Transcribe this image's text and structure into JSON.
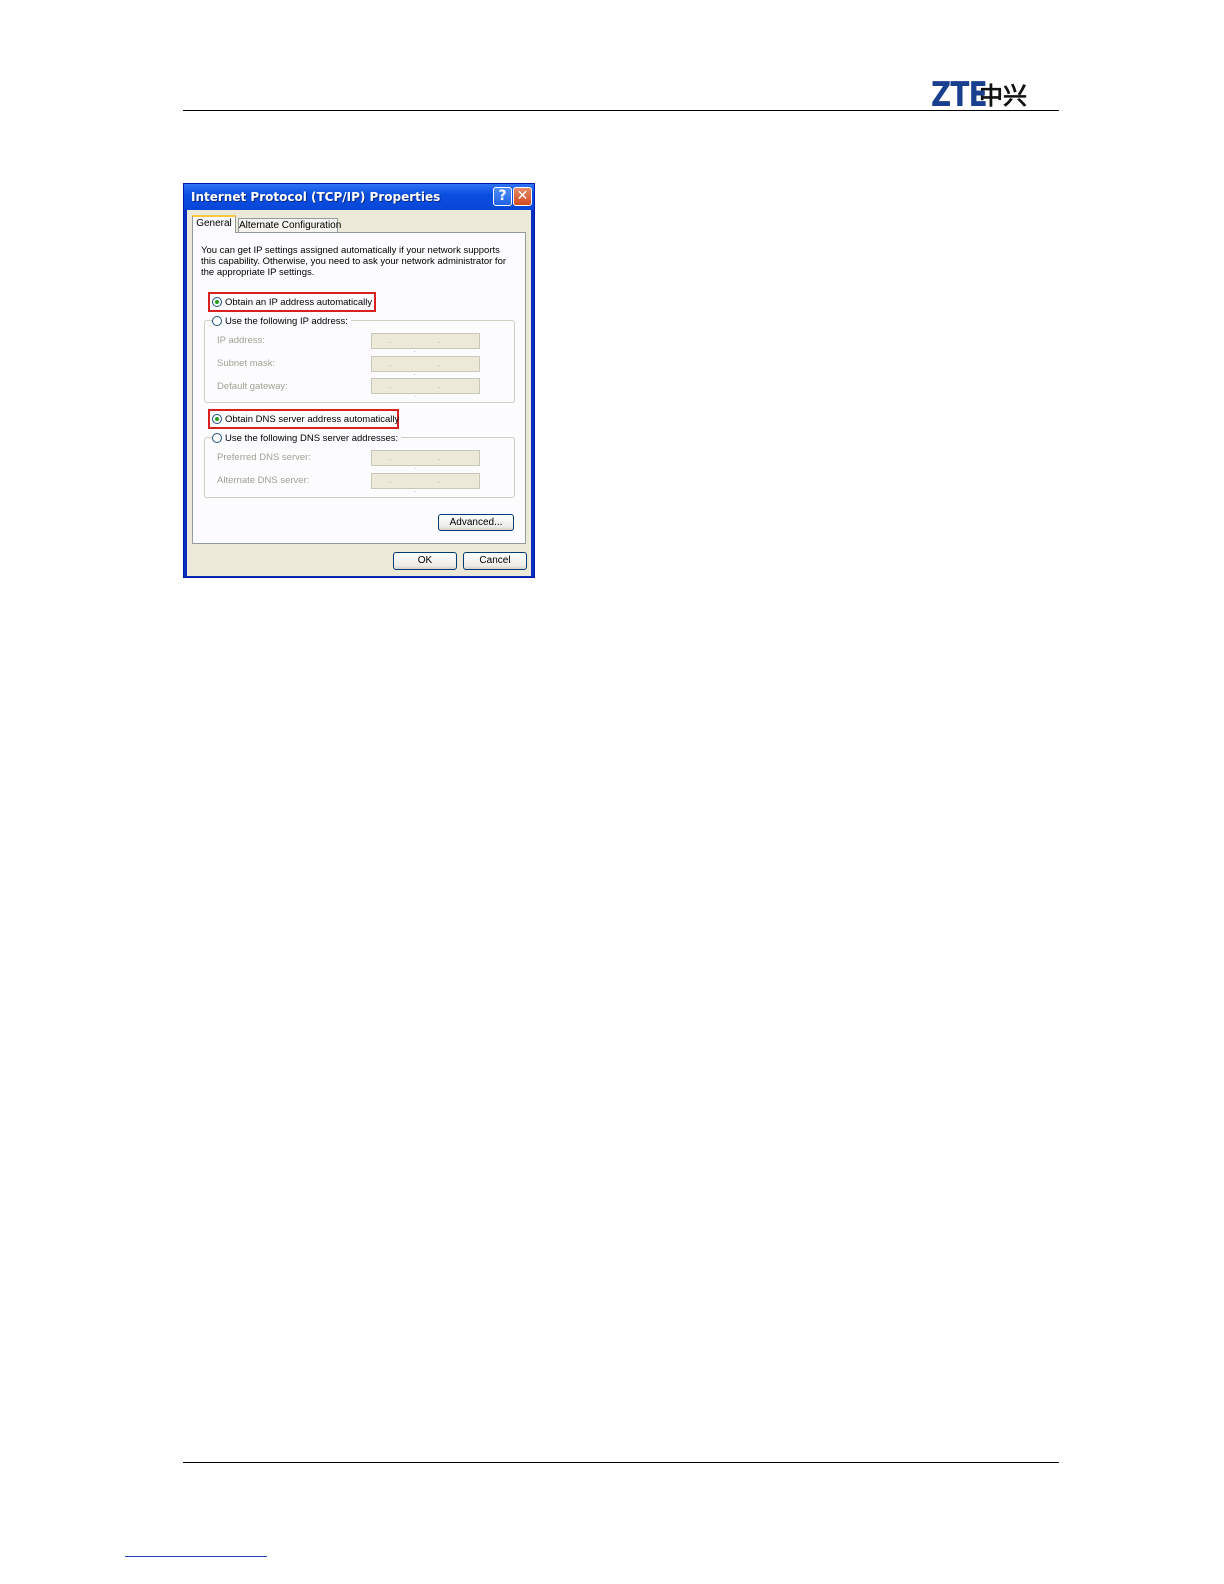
{
  "header": {
    "logo_latin": "ZTE",
    "logo_chinese": "中兴"
  },
  "dialog": {
    "title": "Internet Protocol (TCP/IP) Properties",
    "help_glyph": "?",
    "close_glyph": "✕",
    "tabs": [
      {
        "label": "General",
        "selected": true
      },
      {
        "label": "Alternate Configuration",
        "selected": false
      }
    ],
    "description": "You can get IP settings assigned automatically if your network supports this capability. Otherwise, you need to ask your network administrator for the appropriate IP settings.",
    "ip": {
      "auto_label": "Obtain an IP address automatically",
      "auto_selected": true,
      "manual_label": "Use the following IP address:",
      "fields": [
        {
          "label": "IP address:",
          "value": ". . ."
        },
        {
          "label": "Subnet mask:",
          "value": ". . ."
        },
        {
          "label": "Default gateway:",
          "value": ". . ."
        }
      ]
    },
    "dns": {
      "auto_label": "Obtain DNS server address automatically",
      "auto_selected": true,
      "manual_label": "Use the following DNS server addresses:",
      "fields": [
        {
          "label": "Preferred DNS server:",
          "value": ". . ."
        },
        {
          "label": "Alternate DNS server:",
          "value": ". . ."
        }
      ]
    },
    "advanced_label": "Advanced...",
    "ok_label": "OK",
    "cancel_label": "Cancel"
  },
  "colors": {
    "highlight_box": "#d8201e",
    "titlebar": "#0a4fe0",
    "logo_blue": "#1a3f8f"
  }
}
